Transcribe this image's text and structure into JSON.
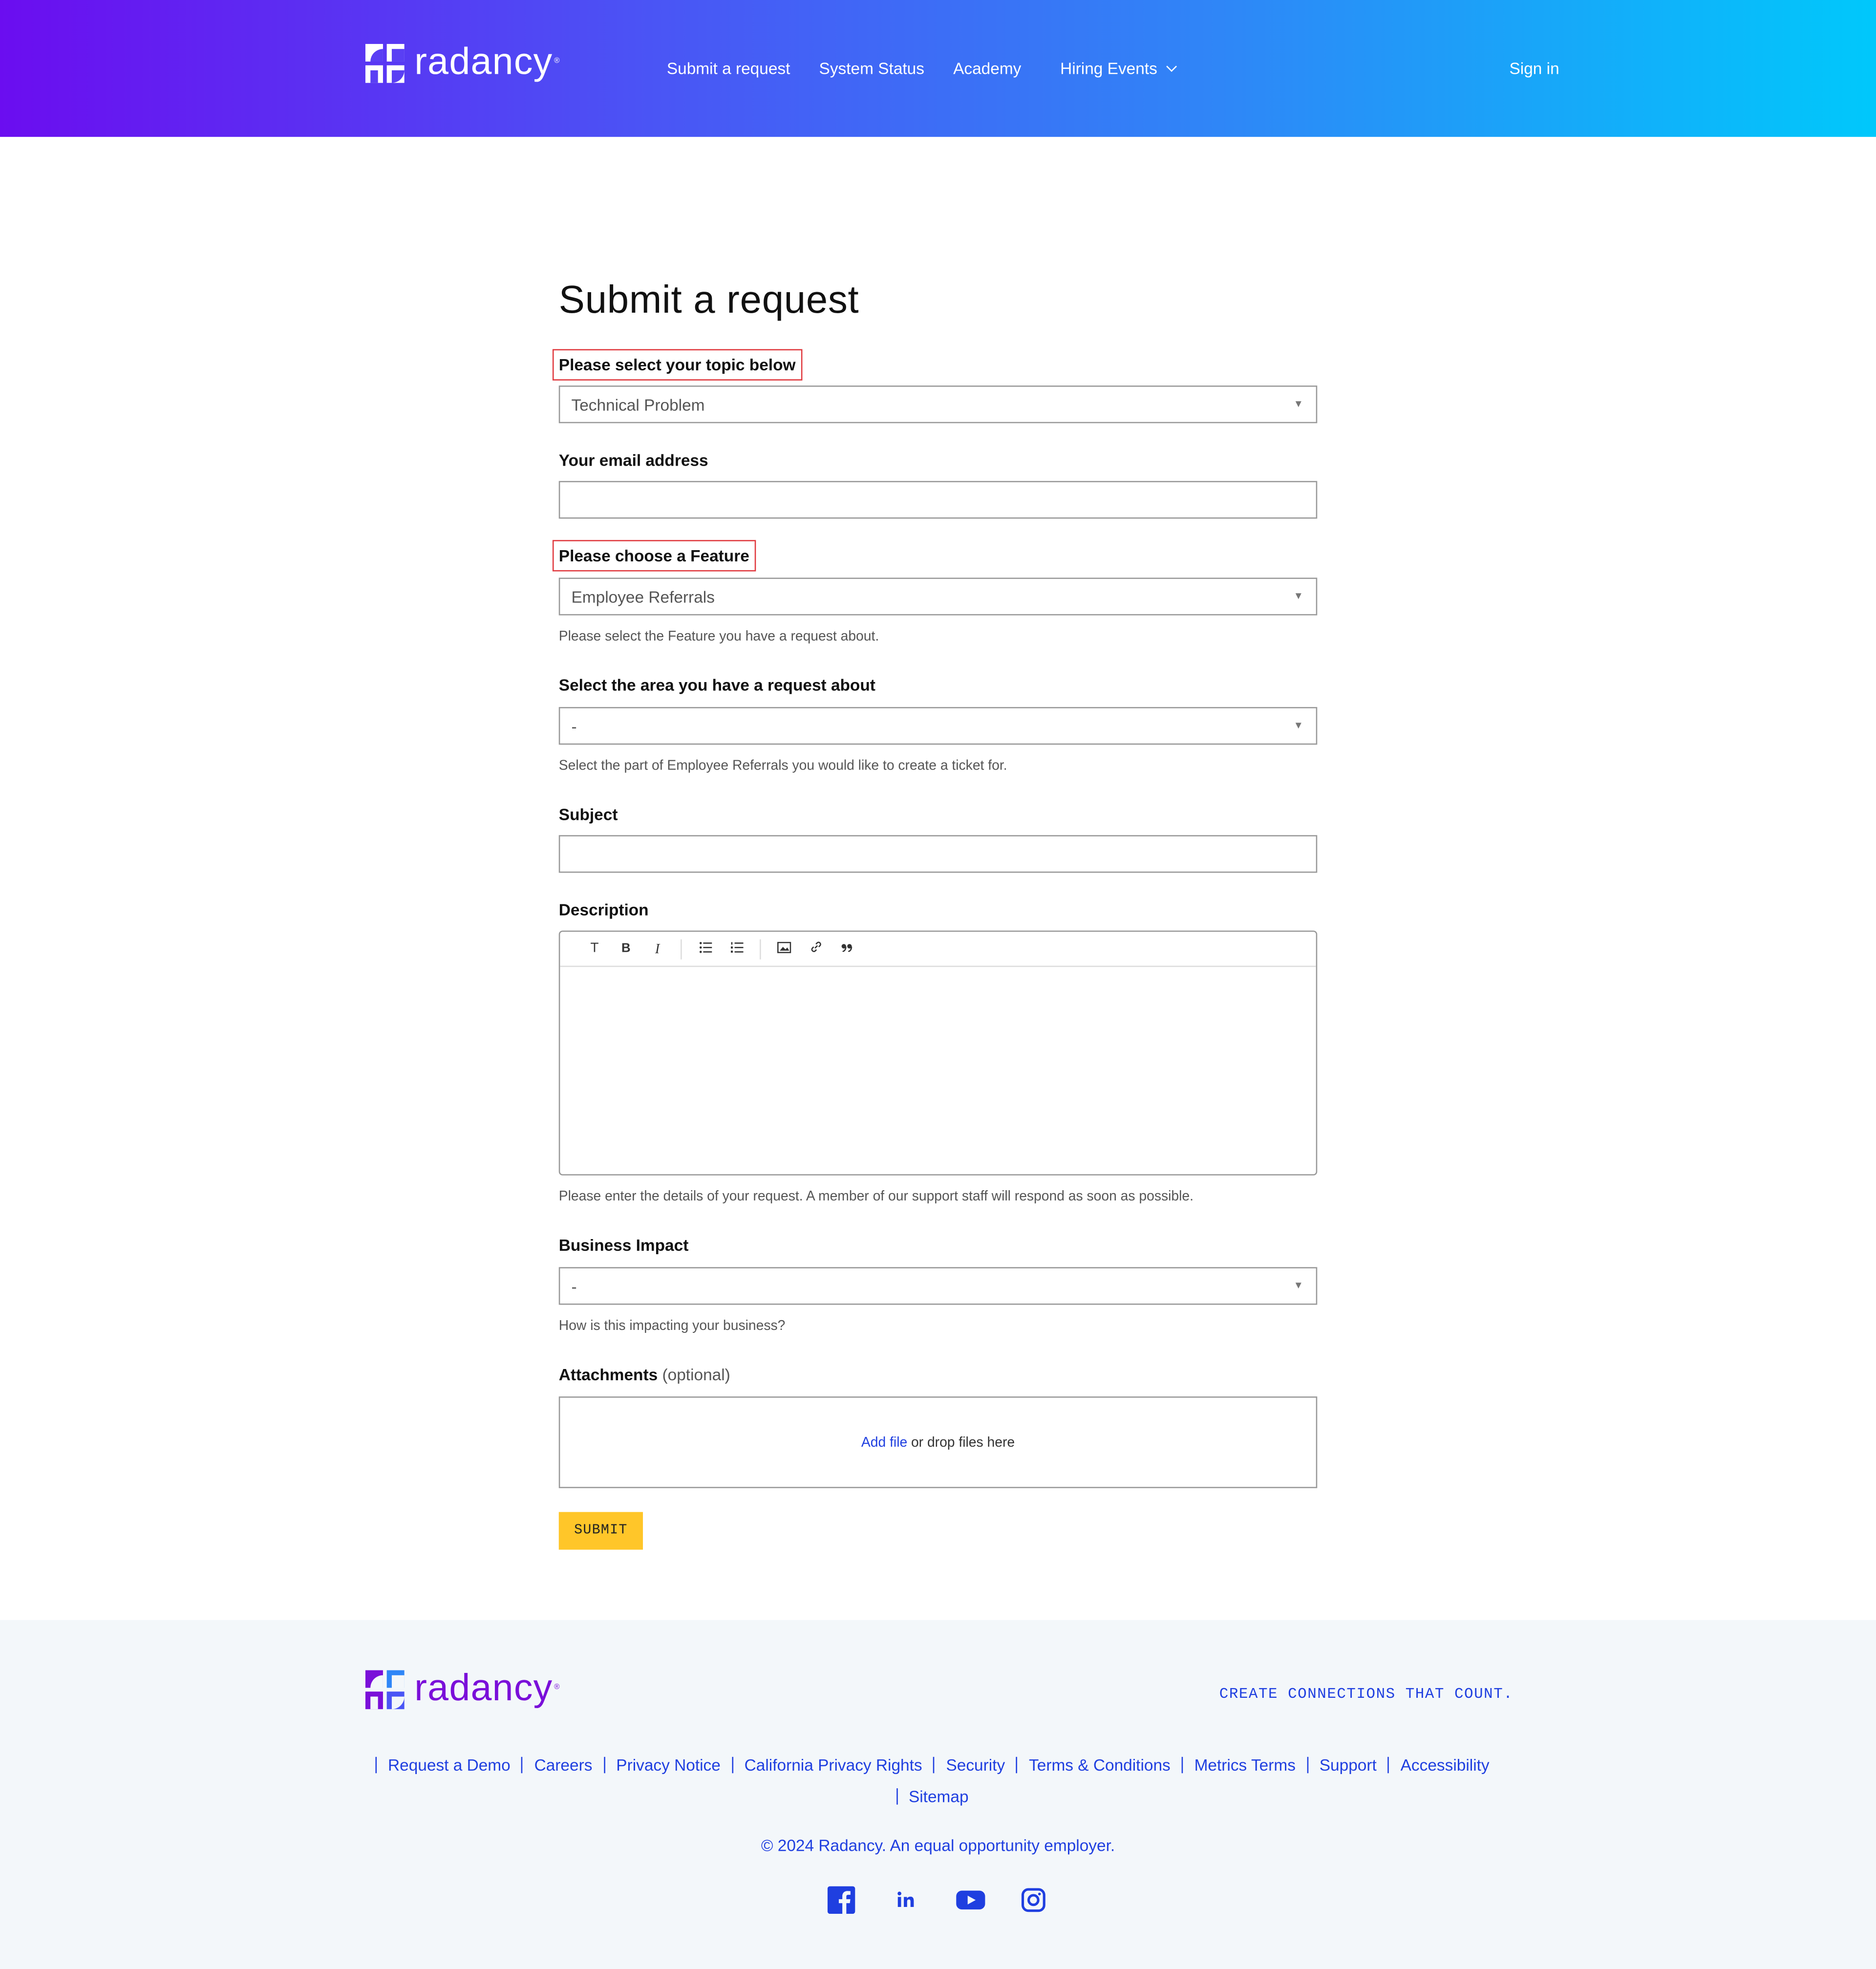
{
  "header": {
    "logo_text": "radancy",
    "logo_tm": "®",
    "nav": [
      "Submit a request",
      "System Status",
      "Academy",
      "Hiring Events"
    ],
    "sign_in": "Sign in"
  },
  "form": {
    "title": "Submit a request",
    "topic": {
      "label": "Please select your topic below",
      "value": "Technical Problem"
    },
    "email": {
      "label": "Your email address",
      "value": ""
    },
    "feature": {
      "label": "Please choose a Feature",
      "value": "Employee Referrals",
      "hint": "Please select the Feature you have a request about."
    },
    "area": {
      "label": "Select the area you have a request about",
      "value": "-",
      "hint": "Select the part of Employee Referrals you would like to create a ticket for."
    },
    "subject": {
      "label": "Subject",
      "value": ""
    },
    "description": {
      "label": "Description",
      "toolbar": [
        "T",
        "B",
        "I"
      ],
      "hint": "Please enter the details of your request. A member of our support staff will respond as soon as possible."
    },
    "impact": {
      "label": "Business Impact",
      "value": "-",
      "hint": "How is this impacting your business?"
    },
    "attachments": {
      "label": "Attachments",
      "optional": "(optional)",
      "add_file": "Add file",
      "drop_text": "or drop files here"
    },
    "submit_label": "SUBMIT"
  },
  "footer": {
    "logo_text": "radancy",
    "logo_tm": "®",
    "tagline": "CREATE CONNECTIONS THAT COUNT.",
    "links_row1": [
      "Request a Demo",
      "Careers",
      "Privacy Notice",
      "California Privacy Rights",
      "Security",
      "Terms & Conditions",
      "Metrics Terms",
      "Support",
      "Accessibility"
    ],
    "links_row2": [
      "Sitemap"
    ],
    "copyright": "© 2024 Radancy. An equal opportunity employer.",
    "social_icons": [
      "facebook-icon",
      "linkedin-icon",
      "youtube-icon",
      "instagram-icon"
    ]
  },
  "colors": {
    "accent": "#1f3fe0",
    "submit": "#ffc629",
    "highlight": "#e0393e",
    "logo_purple": "#7a0fd9"
  }
}
